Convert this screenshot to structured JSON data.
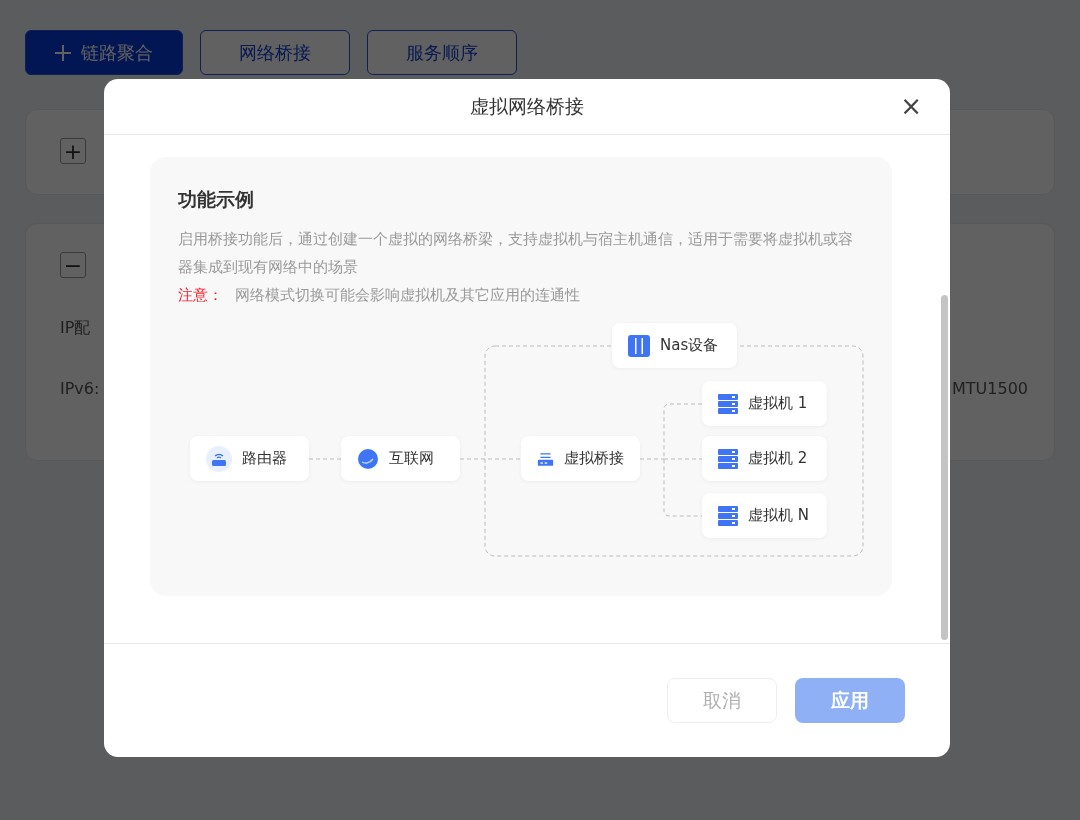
{
  "toolbar": [
    {
      "label": "链路聚合",
      "kind": "primary"
    },
    {
      "label": "网络桥接",
      "kind": "outline"
    },
    {
      "label": "服务顺序",
      "kind": "outline"
    }
  ],
  "background_cards": [
    {
      "toggle": "+"
    },
    {
      "toggle": "−",
      "rows": [
        {
          "label": "IP配"
        },
        {
          "label": "IPv6:",
          "value": "MTU1500"
        }
      ]
    }
  ],
  "dialog": {
    "title": "虚拟网络桥接",
    "close": "×",
    "section": {
      "heading": "功能示例",
      "description": "启用桥接功能后，通过创建一个虚拟的网络桥梁，支持虚拟机与宿主机通信，适用于需要将虚拟机或容器集成到现有网络中的场景",
      "note_label": "注意：",
      "note": "网络模式切换可能会影响虚拟机及其它应用的连通性"
    },
    "diagram": {
      "nodes": [
        {
          "label": "路由器",
          "kind": "router"
        },
        {
          "label": "互联网",
          "kind": "internet"
        },
        {
          "label": "虚拟桥接",
          "kind": "bridge"
        },
        {
          "label": "Nas设备",
          "kind": "nas"
        },
        {
          "label": "虚拟机 1",
          "kind": "vm"
        },
        {
          "label": "虚拟机 2",
          "kind": "vm"
        },
        {
          "label": "虚拟机 N",
          "kind": "vm"
        }
      ]
    },
    "buttons": [
      {
        "label": "取消",
        "kind": "cancel",
        "disabled": true
      },
      {
        "label": "应用",
        "kind": "apply",
        "disabled": true
      }
    ]
  }
}
